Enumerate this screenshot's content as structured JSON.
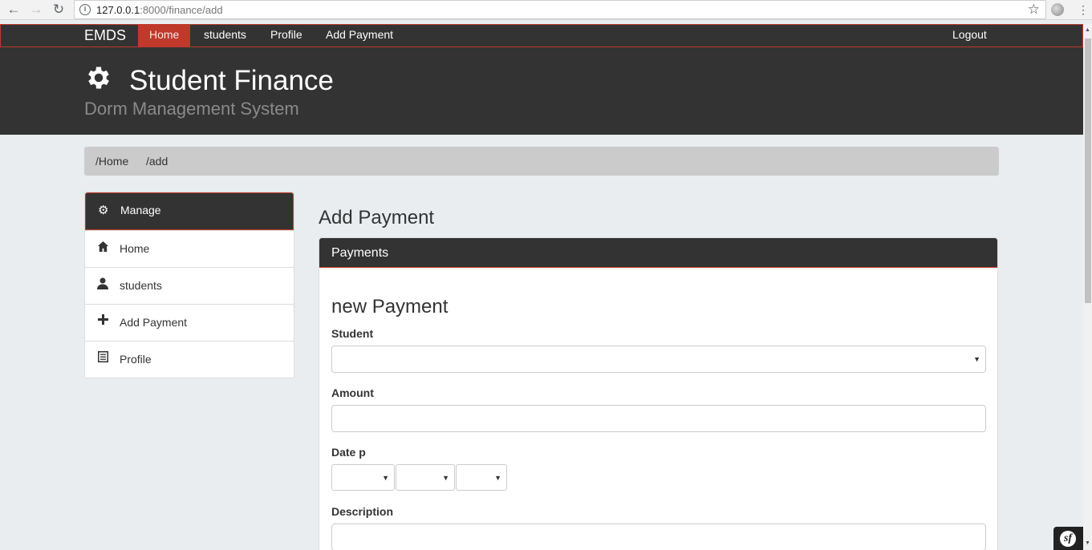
{
  "browser": {
    "url_host": "127.0.0.1",
    "url_rest": ":8000/finance/add"
  },
  "navbar": {
    "brand": "EMDS",
    "links": [
      "Home",
      "students",
      "Profile",
      "Add Payment"
    ],
    "logout": "Logout"
  },
  "header": {
    "title": "Student Finance",
    "subtitle": "Dorm Management System"
  },
  "breadcrumb": [
    "/Home",
    "/add"
  ],
  "sidebar": {
    "heading": "Manage",
    "items": [
      {
        "label": "Home",
        "icon": "home-icon"
      },
      {
        "label": "students",
        "icon": "user-icon"
      },
      {
        "label": "Add Payment",
        "icon": "plus-icon"
      },
      {
        "label": "Profile",
        "icon": "list-icon"
      }
    ]
  },
  "main": {
    "heading": "Add Payment",
    "panel_title": "Payments",
    "form_title": "new Payment",
    "fields": {
      "student_label": "Student",
      "student_value": "",
      "amount_label": "Amount",
      "amount_value": "",
      "date_label": "Date p",
      "description_label": "Description",
      "description_value": ""
    }
  },
  "colors": {
    "dark": "#333333",
    "accent": "#c0392b",
    "background": "#e9edf0",
    "breadcrumb_bg": "#cbcbcb"
  }
}
